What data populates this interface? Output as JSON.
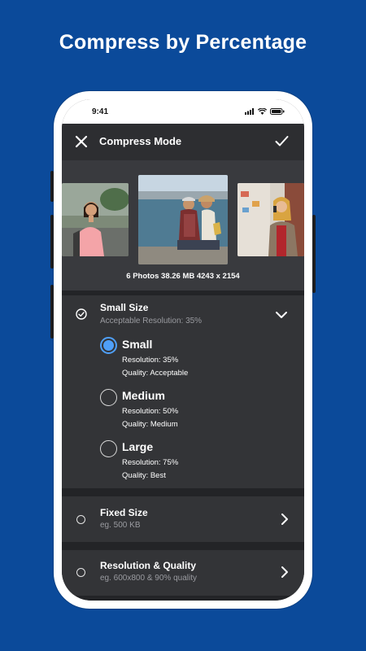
{
  "headline": "Compress by Percentage",
  "status": {
    "time": "9:41"
  },
  "appbar": {
    "title": "Compress Mode",
    "close_icon": "close-icon",
    "confirm_icon": "check-icon"
  },
  "gallery": {
    "summary": "6 Photos  38.26 MB  4243 x 2154"
  },
  "options": [
    {
      "title": "Small Size",
      "subtitle": "Acceptable Resolution: 35%",
      "checked": true,
      "expanded": true,
      "sub_options": [
        {
          "title": "Small",
          "resolution": "Resolution: 35%",
          "quality": "Quality: Acceptable",
          "selected": true
        },
        {
          "title": "Medium",
          "resolution": "Resolution: 50%",
          "quality": "Quality: Medium",
          "selected": false
        },
        {
          "title": "Large",
          "resolution": "Resolution: 75%",
          "quality": "Quality: Best",
          "selected": false
        }
      ]
    },
    {
      "title": "Fixed Size",
      "subtitle": "eg. 500 KB",
      "checked": false
    },
    {
      "title": "Resolution & Quality",
      "subtitle": "eg. 600x800 & 90% quality",
      "checked": false
    }
  ],
  "colors": {
    "background": "#0b4a9a",
    "accent": "#4f9ff8",
    "panel": "#333437"
  }
}
